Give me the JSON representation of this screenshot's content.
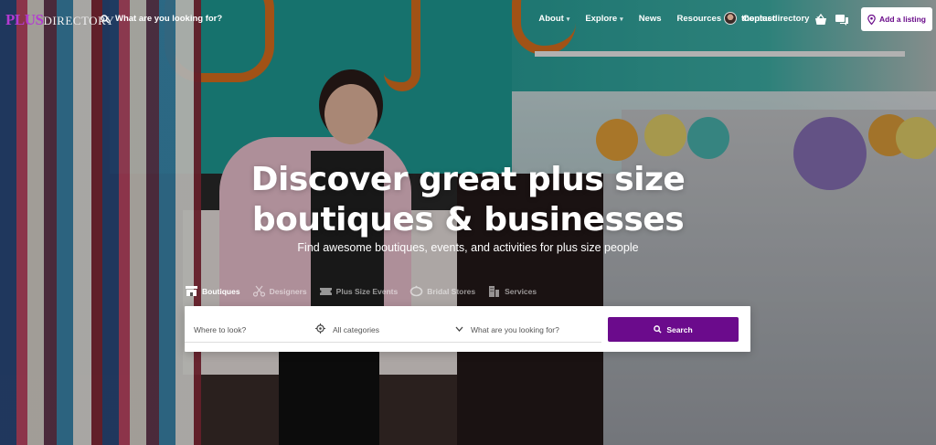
{
  "brand": {
    "plus": "PLUS",
    "directory": "DIRECTORY",
    "accent": "#b43bd1",
    "primary": "#6b0b8c"
  },
  "header": {
    "search_label": "What are you looking for?",
    "nav": [
      {
        "label": "About",
        "dropdown": true
      },
      {
        "label": "Explore",
        "dropdown": true
      },
      {
        "label": "News",
        "dropdown": false
      },
      {
        "label": "Resources",
        "dropdown": true
      },
      {
        "label": "Contact",
        "dropdown": false
      }
    ],
    "username": "theplusdirectory",
    "add_listing": "Add a listing",
    "icons": [
      "search-icon",
      "basket-icon",
      "chat-icon",
      "location-pin-icon"
    ]
  },
  "hero": {
    "title_line1": "Discover great plus size",
    "title_line2": "boutiques & businesses",
    "subtitle": "Find awesome boutiques, events, and activities for plus size people"
  },
  "categories": [
    {
      "label": "Boutiques",
      "icon": "storefront-icon",
      "active": true
    },
    {
      "label": "Designers",
      "icon": "scissors-icon",
      "active": false
    },
    {
      "label": "Plus Size Events",
      "icon": "ticket-icon",
      "active": false
    },
    {
      "label": "Bridal Stores",
      "icon": "ring-icon",
      "active": false
    },
    {
      "label": "Services",
      "icon": "building-icon",
      "active": false
    }
  ],
  "search": {
    "where_placeholder": "Where to look?",
    "category_value": "All categories",
    "what_placeholder": "What are you looking for?",
    "button_label": "Search"
  }
}
